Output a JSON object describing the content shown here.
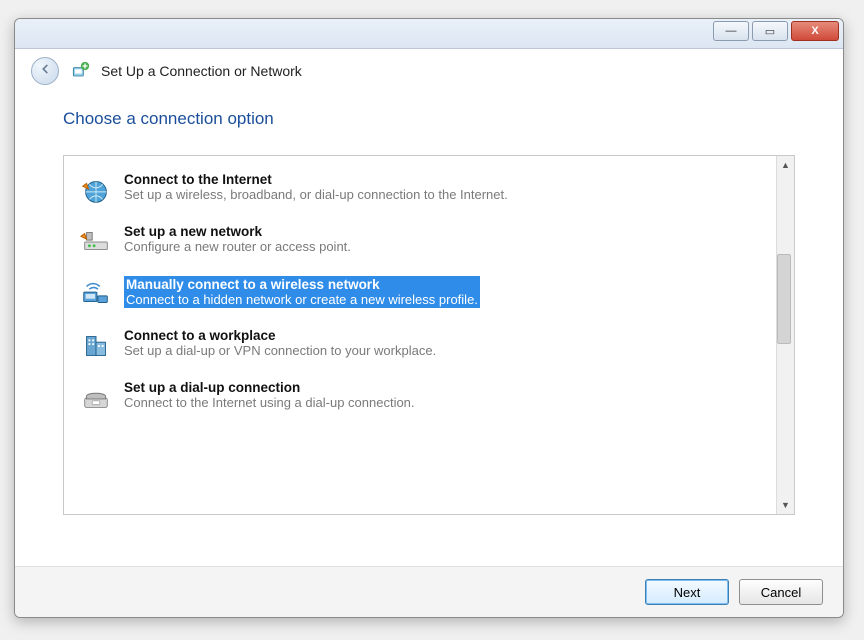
{
  "window": {
    "title": "Set Up a Connection or Network"
  },
  "heading": "Choose a connection option",
  "options": [
    {
      "title": "Connect to the Internet",
      "desc": "Set up a wireless, broadband, or dial-up connection to the Internet.",
      "icon": "globe-icon",
      "selected": false
    },
    {
      "title": "Set up a new network",
      "desc": "Configure a new router or access point.",
      "icon": "router-icon",
      "selected": false
    },
    {
      "title": "Manually connect to a wireless network",
      "desc": "Connect to a hidden network or create a new wireless profile.",
      "icon": "wireless-icon",
      "selected": true
    },
    {
      "title": "Connect to a workplace",
      "desc": "Set up a dial-up or VPN connection to your workplace.",
      "icon": "building-icon",
      "selected": false
    },
    {
      "title": "Set up a dial-up connection",
      "desc": "Connect to the Internet using a dial-up connection.",
      "icon": "phone-icon",
      "selected": false
    }
  ],
  "buttons": {
    "next": "Next",
    "cancel": "Cancel"
  },
  "chrome": {
    "minimize": "—",
    "maximize": "▭",
    "close": "X"
  }
}
